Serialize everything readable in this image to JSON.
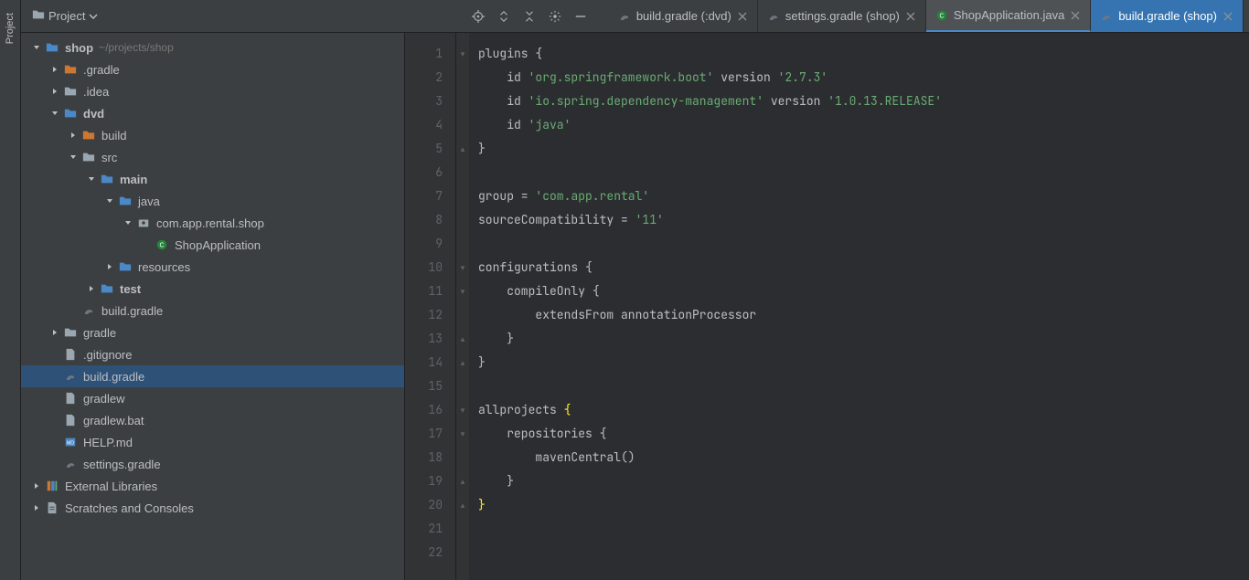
{
  "rail": {
    "project": "Project"
  },
  "toolbar": {
    "project_label": "Project"
  },
  "tabs": [
    {
      "label": "build.gradle (:dvd)",
      "icon": "gradle",
      "active": false
    },
    {
      "label": "settings.gradle (shop)",
      "icon": "gradle",
      "active": false
    },
    {
      "label": "ShopApplication.java",
      "icon": "java",
      "active": true
    },
    {
      "label": "build.gradle (shop)",
      "icon": "gradle",
      "active": false,
      "highlight": true
    }
  ],
  "tree": {
    "nodes": [
      {
        "depth": 0,
        "arrow": "down",
        "icon": "folder-blue",
        "label": "shop",
        "bold": true,
        "path": "~/projects/shop"
      },
      {
        "depth": 1,
        "arrow": "right",
        "icon": "folder-ex",
        "label": ".gradle"
      },
      {
        "depth": 1,
        "arrow": "right",
        "icon": "folder",
        "label": ".idea"
      },
      {
        "depth": 1,
        "arrow": "down",
        "icon": "folder-blue",
        "label": "dvd",
        "bold": true
      },
      {
        "depth": 2,
        "arrow": "right",
        "icon": "folder-ex",
        "label": "build"
      },
      {
        "depth": 2,
        "arrow": "down",
        "icon": "folder",
        "label": "src"
      },
      {
        "depth": 3,
        "arrow": "down",
        "icon": "folder-blue",
        "label": "main",
        "bold": true
      },
      {
        "depth": 4,
        "arrow": "down",
        "icon": "folder-blue",
        "label": "java"
      },
      {
        "depth": 5,
        "arrow": "down",
        "icon": "package",
        "label": "com.app.rental.shop"
      },
      {
        "depth": 6,
        "arrow": "none",
        "icon": "class",
        "label": "ShopApplication"
      },
      {
        "depth": 4,
        "arrow": "right",
        "icon": "folder-blue",
        "label": "resources"
      },
      {
        "depth": 3,
        "arrow": "right",
        "icon": "folder-blue",
        "label": "test",
        "bold": true
      },
      {
        "depth": 2,
        "arrow": "none",
        "icon": "gradle",
        "label": "build.gradle"
      },
      {
        "depth": 1,
        "arrow": "right",
        "icon": "folder",
        "label": "gradle"
      },
      {
        "depth": 1,
        "arrow": "none",
        "icon": "file",
        "label": ".gitignore"
      },
      {
        "depth": 1,
        "arrow": "none",
        "icon": "gradle",
        "label": "build.gradle",
        "selected": true
      },
      {
        "depth": 1,
        "arrow": "none",
        "icon": "file",
        "label": "gradlew"
      },
      {
        "depth": 1,
        "arrow": "none",
        "icon": "file",
        "label": "gradlew.bat"
      },
      {
        "depth": 1,
        "arrow": "none",
        "icon": "md",
        "label": "HELP.md"
      },
      {
        "depth": 1,
        "arrow": "none",
        "icon": "gradle",
        "label": "settings.gradle"
      },
      {
        "depth": 0,
        "arrow": "right",
        "icon": "lib",
        "label": "External Libraries"
      },
      {
        "depth": 0,
        "arrow": "right",
        "icon": "scratch",
        "label": "Scratches and Consoles"
      }
    ]
  },
  "editor": {
    "line_numbers": [
      "1",
      "2",
      "3",
      "4",
      "5",
      "6",
      "7",
      "8",
      "9",
      "10",
      "11",
      "12",
      "13",
      "14",
      "15",
      "16",
      "17",
      "18",
      "19",
      "20",
      "21",
      "22"
    ],
    "lines": [
      [
        [
          "id",
          "plugins "
        ],
        [
          "br",
          "{"
        ]
      ],
      [
        [
          "pad",
          "    "
        ],
        [
          "id",
          "id "
        ],
        [
          "str",
          "'org.springframework.boot'"
        ],
        [
          "id",
          " version "
        ],
        [
          "str",
          "'2.7.3'"
        ]
      ],
      [
        [
          "pad",
          "    "
        ],
        [
          "id",
          "id "
        ],
        [
          "str",
          "'io.spring.dependency-management'"
        ],
        [
          "id",
          " version "
        ],
        [
          "str",
          "'1.0.13.RELEASE'"
        ]
      ],
      [
        [
          "pad",
          "    "
        ],
        [
          "id",
          "id "
        ],
        [
          "str",
          "'java'"
        ]
      ],
      [
        [
          "br",
          "}"
        ]
      ],
      [],
      [
        [
          "id",
          "group = "
        ],
        [
          "str",
          "'com.app.rental'"
        ]
      ],
      [
        [
          "id",
          "sourceCompatibility = "
        ],
        [
          "str",
          "'11'"
        ]
      ],
      [],
      [
        [
          "id",
          "configurations "
        ],
        [
          "br",
          "{"
        ]
      ],
      [
        [
          "pad",
          "    "
        ],
        [
          "id",
          "compileOnly "
        ],
        [
          "br",
          "{"
        ]
      ],
      [
        [
          "pad",
          "        "
        ],
        [
          "id",
          "extendsFrom annotationProcessor"
        ]
      ],
      [
        [
          "pad",
          "    "
        ],
        [
          "br",
          "}"
        ]
      ],
      [
        [
          "br",
          "}"
        ]
      ],
      [],
      [
        [
          "id",
          "allprojects "
        ],
        [
          "hlbr",
          "{"
        ]
      ],
      [
        [
          "pad",
          "    "
        ],
        [
          "id",
          "repositories "
        ],
        [
          "br",
          "{"
        ]
      ],
      [
        [
          "pad",
          "        "
        ],
        [
          "id",
          "mavenCentral()"
        ]
      ],
      [
        [
          "pad",
          "    "
        ],
        [
          "br",
          "}"
        ]
      ],
      [
        [
          "hlbr",
          "}"
        ]
      ],
      [],
      []
    ]
  }
}
